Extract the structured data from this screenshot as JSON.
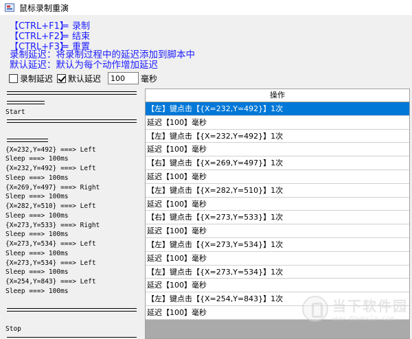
{
  "window": {
    "title": "鼠标录制重演"
  },
  "shortcuts": [
    {
      "key": "【CTRL+F1】",
      "action": "= 录制"
    },
    {
      "key": "【CTRL+F2】",
      "action": "= 结束"
    },
    {
      "key": "【CTRL+F3】",
      "action": "= 重置"
    }
  ],
  "descriptions": [
    "录制延迟：将录制过程中的延迟添加到脚本中",
    "默认延迟：默认为每个动作增加延迟"
  ],
  "options": {
    "record_delay": {
      "label": "录制延迟",
      "checked": false
    },
    "default_delay": {
      "label": "默认延迟",
      "checked": true
    },
    "delay_value": "100",
    "unit": "毫秒"
  },
  "log": {
    "start": "Start",
    "lines": [
      "{X=232,Y=492} ===> Left",
      "Sleep ===> 100ms",
      "{X=232,Y=492} ===> Left",
      "Sleep ===> 100ms",
      "{X=269,Y=497} ===> Right",
      "Sleep ===> 100ms",
      "{X=282,Y=510} ===> Left",
      "Sleep ===> 100ms",
      "{X=273,Y=533} ===> Right",
      "Sleep ===> 100ms",
      "{X=273,Y=534} ===> Left",
      "Sleep ===> 100ms",
      "{X=273,Y=534} ===> Left",
      "Sleep ===> 100ms",
      "{X=254,Y=843} ===> Left",
      "Sleep ===> 100ms"
    ],
    "stop": "Stop"
  },
  "operations": {
    "header": "操作",
    "selected_index": 0,
    "rows": [
      "【左】键点击【{X=232,Y=492}】1次",
      "延迟【100】毫秒",
      "【左】键点击【{X=232,Y=492}】1次",
      "延迟【100】毫秒",
      "【右】键点击【{X=269,Y=497}】1次",
      "延迟【100】毫秒",
      "【左】键点击【{X=282,Y=510}】1次",
      "延迟【100】毫秒",
      "【右】键点击【{X=273,Y=533}】1次",
      "延迟【100】毫秒",
      "【左】键点击【{X=273,Y=534}】1次",
      "延迟【100】毫秒",
      "【左】键点击【{X=273,Y=534}】1次",
      "延迟【100】毫秒",
      "【左】键点击【{X=254,Y=843}】1次",
      "延迟【100】毫秒"
    ]
  },
  "watermark": {
    "brand": "当下软件园",
    "url": "www.downxia.com"
  }
}
